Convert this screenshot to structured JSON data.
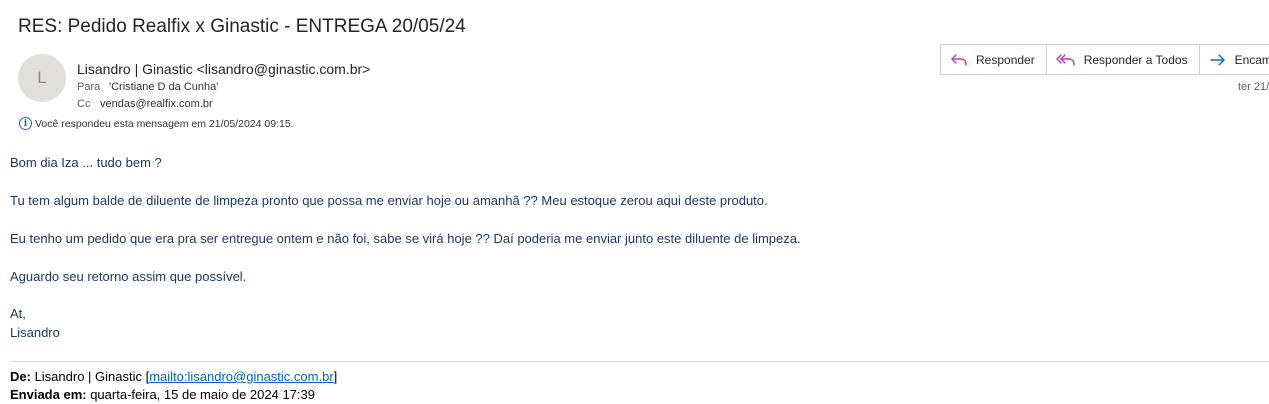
{
  "email": {
    "subject": "RES: Pedido Realfix  x  Ginastic - ENTREGA 20/05/24",
    "avatar_initial": "L",
    "sender": "Lisandro | Ginastic <lisandro@ginastic.com.br>",
    "to_label": "Para",
    "to_value": "'Cristiane D da Cunha'",
    "cc_label": "Cc",
    "cc_value": "vendas@realfix.com.br",
    "info_text": "Você respondeu esta mensagem em 21/05/2024 09:15.",
    "date_partial": "ter 21/"
  },
  "actions": {
    "reply": "Responder",
    "reply_all": "Responder a Todos",
    "forward": "Encaminhar"
  },
  "body": {
    "greeting": "Bom dia Iza ... tudo bem ?",
    "line1": "Tu tem algum balde de diluente de limpeza pronto que possa me enviar hoje ou amanhã ??  Meu estoque zerou aqui deste produto.",
    "line2": "Eu tenho um pedido que era pra ser entregue ontem e não foi, sabe se virá hoje ??  Daí poderia me enviar junto este diluente de limpeza.",
    "line3": "Aguardo seu retorno assim que possível.",
    "closing": "At,",
    "signature": "Lisandro"
  },
  "quoted": {
    "from_label": "De:",
    "from_name": " Lisandro | Ginastic [",
    "from_link": "mailto:lisandro@ginastic.com.br",
    "from_end": "]",
    "sent_label": "Enviada em:",
    "sent_value": " quarta-feira, 15 de maio de 2024 17:39"
  },
  "colors": {
    "body_text": "#1f3864",
    "accent": "#0f6cbd",
    "reply_icon": "#c239b3",
    "forward_icon": "#0f6cbd"
  },
  "icons": {
    "reply": "reply-arrow-icon",
    "reply_all": "reply-all-arrow-icon",
    "forward": "forward-arrow-icon",
    "info": "info-circle-icon"
  }
}
